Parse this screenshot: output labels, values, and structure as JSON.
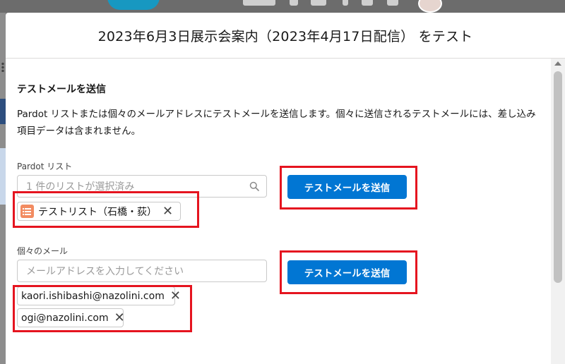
{
  "modal": {
    "title": "2023年6月3日展示会案内（2023年4月17日配信） をテスト"
  },
  "section": {
    "title": "テストメールを送信",
    "description": "Pardot リストまたは個々のメールアドレスにテストメールを送信します。個々に送信されるテストメールには、差し込み項目データは含まれません。"
  },
  "pardot_list": {
    "label": "Pardot リスト",
    "placeholder": "1 件のリストが選択済み",
    "selected": [
      {
        "label": "テストリスト（石橋・荻）",
        "icon": "list-icon"
      }
    ],
    "send_button": "テストメールを送信"
  },
  "individual_email": {
    "label": "個々のメール",
    "placeholder": "メールアドレスを入力してください",
    "recipients": [
      "kaori.ishibashi@nazolini.com",
      "ogi@nazolini.com"
    ],
    "send_button": "テストメールを送信"
  },
  "colors": {
    "brand_button": "#0176d3",
    "highlight": "#e5141f",
    "list_icon": "#f28b61"
  }
}
